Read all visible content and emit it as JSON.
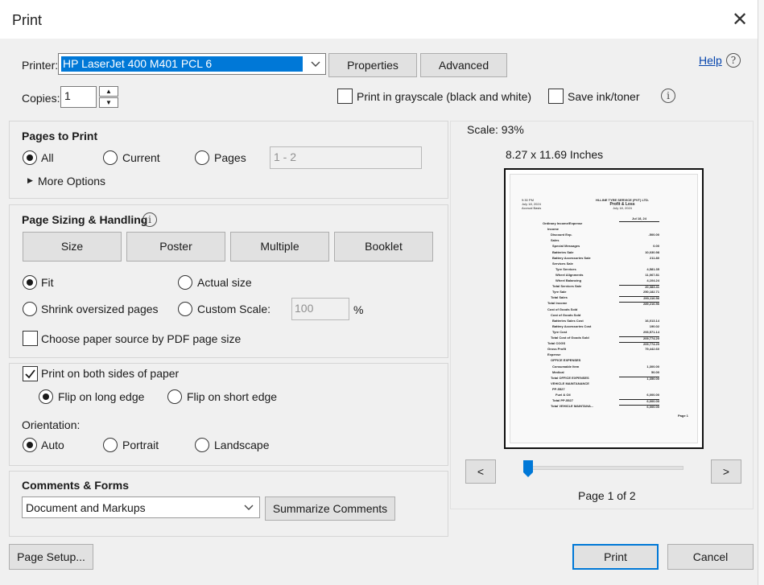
{
  "window": {
    "title": "Print"
  },
  "printer": {
    "label": "Printer:",
    "selected": "HP LaserJet 400 M401 PCL 6",
    "properties": "Properties",
    "advanced": "Advanced",
    "help": "Help"
  },
  "copies": {
    "label": "Copies:",
    "value": "1"
  },
  "options": {
    "grayscale": "Print in grayscale (black and white)",
    "save_ink": "Save ink/toner"
  },
  "pages_to_print": {
    "title": "Pages to Print",
    "all": "All",
    "current": "Current",
    "pages": "Pages",
    "pages_placeholder": "1 - 2",
    "more": "More Options"
  },
  "sizing": {
    "title": "Page Sizing & Handling",
    "size": "Size",
    "poster": "Poster",
    "multiple": "Multiple",
    "booklet": "Booklet",
    "fit": "Fit",
    "actual": "Actual size",
    "shrink": "Shrink oversized pages",
    "custom": "Custom Scale:",
    "custom_value": "100",
    "percent": "%",
    "choose_source": "Choose paper source by PDF page size"
  },
  "duplex": {
    "both_sides": "Print on both sides of paper",
    "long_edge": "Flip on long edge",
    "short_edge": "Flip on short edge"
  },
  "orientation": {
    "label": "Orientation:",
    "auto": "Auto",
    "portrait": "Portrait",
    "landscape": "Landscape"
  },
  "comments": {
    "title": "Comments & Forms",
    "selected": "Document and Markups",
    "summarize": "Summarize Comments"
  },
  "preview": {
    "scale": "Scale:  93%",
    "dims": "8.27 x 11.69 Inches",
    "page_label": "Page 1 of 2",
    "prev": "<",
    "next": ">",
    "slider_value": 0.0
  },
  "footer": {
    "page_setup": "Page Setup...",
    "print": "Print",
    "cancel": "Cancel"
  },
  "colors": {
    "accent": "#0078d7",
    "link": "#0645ad"
  },
  "doc": {
    "time": "9:30 PM",
    "date": "July 18, 2024",
    "basis": "Accrual Basis",
    "company": "HI-LINE TYRE SERVICE (PVT) LTD.",
    "report": "Profit & Loss",
    "period": "July 18, 2024",
    "col": "Jul 18, 24",
    "page_no": "Page 1",
    "lines": [
      {
        "t": "Ordinary Income/Expense",
        "v": ""
      },
      {
        "t": "Income",
        "v": ""
      },
      {
        "t": "Discount Exp.",
        "v": "-500.00"
      },
      {
        "t": "Sales",
        "v": ""
      },
      {
        "t": "Special Messages",
        "v": "0.00"
      },
      {
        "t": "Batteries Sale",
        "v": "10,030.98"
      },
      {
        "t": "Battery Accessories Sale",
        "v": "211.80"
      },
      {
        "t": "Services Sale",
        "v": ""
      },
      {
        "t": "Tyre Services",
        "v": "4,581.35"
      },
      {
        "t": "Wheel Alignments",
        "v": "11,067.81"
      },
      {
        "t": "Wheel Balancing",
        "v": "4,104.24"
      },
      {
        "t": "Total Services Sale",
        "v": "20,383.41"
      },
      {
        "t": "Tyre Sale",
        "v": "250,182.71"
      },
      {
        "t": "Total Sales",
        "v": "290,116.56"
      },
      {
        "t": "Total Income",
        "v": "289,216.56"
      },
      {
        "t": "Cost of Goods Sold",
        "v": ""
      },
      {
        "t": "Cost of Goods Sold",
        "v": ""
      },
      {
        "t": "Batteries Sales Cost",
        "v": "16,013.14"
      },
      {
        "t": "Battery Accessories Cost",
        "v": "190.02"
      },
      {
        "t": "Tyre Cost",
        "v": "293,571.14"
      },
      {
        "t": "Total Cost of Goods Sold",
        "v": "209,774.20"
      },
      {
        "t": "Total COGS",
        "v": "209,774.20"
      },
      {
        "t": "Gross Profit",
        "v": "79,442.60"
      },
      {
        "t": "Expense",
        "v": ""
      },
      {
        "t": "OFFICE EXPENSES",
        "v": ""
      },
      {
        "t": "Consumable Item",
        "v": "1,300.00"
      },
      {
        "t": "Medical",
        "v": "50.00"
      },
      {
        "t": "Total OFFICE EXPENSES",
        "v": "1,350.00"
      },
      {
        "t": "VEHICLE MAINTANANCE",
        "v": ""
      },
      {
        "t": "PP-5527",
        "v": ""
      },
      {
        "t": "Fuel & Oil",
        "v": "6,000.00"
      },
      {
        "t": "Total PP-5527",
        "v": "6,000.00"
      },
      {
        "t": "Total VEHICLE MAINTANA...",
        "v": "6,000.00"
      }
    ]
  }
}
